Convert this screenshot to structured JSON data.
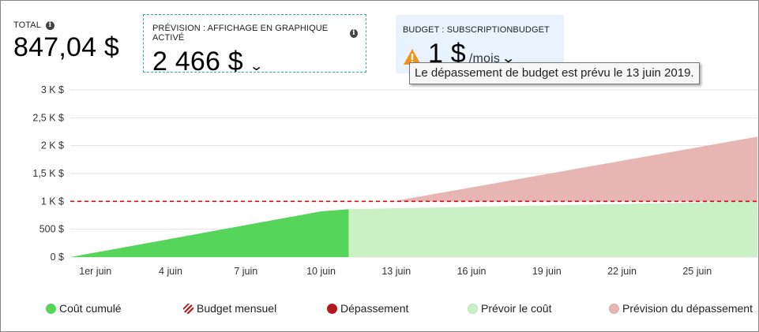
{
  "kpis": {
    "total": {
      "label": "TOTAL",
      "value": "847,04 $"
    },
    "forecast": {
      "label": "PRÉVISION : AFFICHAGE EN GRAPHIQUE ACTIVÉ",
      "value": "2 466 $"
    },
    "budget": {
      "label": "BUDGET : SUBSCRIPTIONBUDGET",
      "value": "1 $",
      "unit": "/mois"
    }
  },
  "tooltip": {
    "text": "Le dépassement de budget est prévu le 13 juin 2019."
  },
  "icons": {
    "info": "info-icon",
    "warning": "warning-icon",
    "expand": "chevron-down-icon"
  },
  "colors": {
    "cumulative": "#57d45a",
    "forecast": "#c9f1c5",
    "overage_forecast": "#e8b5b5",
    "budget_line": "#c0141b",
    "overage": "#b01a1f"
  },
  "chart_data": {
    "type": "area",
    "x_unit": "day of June",
    "xlim": [
      0,
      27.4
    ],
    "ylim": [
      0,
      3000
    ],
    "y_ticks": [
      0,
      500,
      1000,
      1500,
      2000,
      2500,
      3000
    ],
    "y_tick_labels": [
      "0 $",
      "500 $",
      "1 K $",
      "1,5 K $",
      "2 K $",
      "2,5 K $",
      "3 K $"
    ],
    "x_ticks": [
      1,
      4,
      7,
      10,
      13,
      16,
      19,
      22,
      25
    ],
    "x_tick_labels": [
      "1er juin",
      "4 juin",
      "7 juin",
      "10 juin",
      "13 juin",
      "16 juin",
      "19 juin",
      "22 juin",
      "25 juin"
    ],
    "grid": true,
    "budget": 1000,
    "series": [
      {
        "name": "Coût cumulé",
        "points": [
          [
            0,
            0
          ],
          [
            10,
            820
          ],
          [
            11.1,
            860
          ]
        ]
      },
      {
        "name": "Prévoir le coût",
        "points": [
          [
            11.1,
            860
          ],
          [
            27.4,
            2160
          ]
        ]
      },
      {
        "name": "Budget mensuel",
        "value": 1000
      }
    ],
    "legend": [
      {
        "name": "Coût cumulé",
        "marker": "solid",
        "color": "#57d45a"
      },
      {
        "name": "Budget mensuel",
        "marker": "striped",
        "color": "#c0141b"
      },
      {
        "name": "Dépassement",
        "marker": "solid",
        "color": "#b01a1f"
      },
      {
        "name": "Prévoir le coût",
        "marker": "light",
        "color": "#c9f1c5"
      },
      {
        "name": "Prévision du dépassement",
        "marker": "light",
        "color": "#e8b5b5"
      }
    ],
    "legend_position": "bottom"
  }
}
